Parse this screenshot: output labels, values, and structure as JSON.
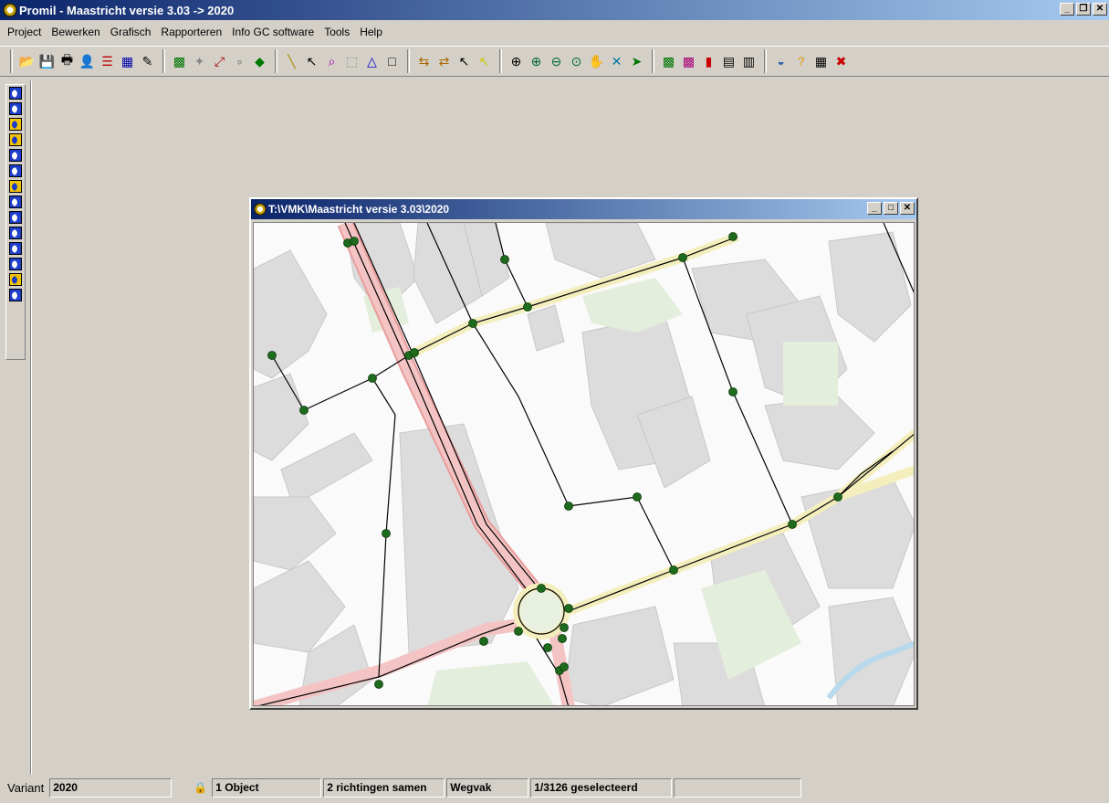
{
  "window": {
    "title": "Promil - Maastricht versie 3.03 -> 2020"
  },
  "menu": [
    "Project",
    "Bewerken",
    "Grafisch",
    "Rapporteren",
    "Info GC software",
    "Tools",
    "Help"
  ],
  "toolbar": {
    "groups": [
      [
        "folder-open-icon",
        "save-icon",
        "print-icon",
        "user-icon",
        "list-icon",
        "table-icon",
        "wizard-icon"
      ],
      [
        "map-edit-icon",
        "node-icon",
        "link-icon",
        "connect-icon",
        "layer-icon"
      ],
      [
        "line-tool-icon",
        "select-arrow-icon",
        "zoom-select-icon",
        "rectangle-dashed-icon",
        "triangle-icon",
        "square-icon"
      ],
      [
        "route-forward-icon",
        "route-back-icon",
        "pointer-icon",
        "pointer-yellow-icon"
      ],
      [
        "zoom-extent-icon",
        "zoom-in-icon",
        "zoom-out-icon",
        "zoom-window-icon",
        "pan-hand-icon",
        "cross-icon",
        "export-icon"
      ],
      [
        "map-stats-icon",
        "map-edit2-icon",
        "bar-chart-icon",
        "report-icon",
        "document-icon"
      ],
      [
        "globe-icon",
        "help-icon",
        "calculator-icon",
        "exit-icon"
      ]
    ]
  },
  "leftbar": [
    "blue",
    "blue",
    "yellow",
    "yellow",
    "blue",
    "blue",
    "yellow",
    "blue",
    "blue",
    "blue",
    "blue",
    "blue",
    "yellow",
    "blue"
  ],
  "mdi": {
    "title": "T:\\VMK\\Maastricht versie 3.03\\2020"
  },
  "status": {
    "variant_label": "Variant",
    "variant_value": "2020",
    "objects": "1 Object",
    "direction": "2 richtingen samen",
    "type": "Wegvak",
    "selected": "1/3126 geselecteerd",
    "extra": ""
  },
  "colors": {
    "titlebar": "#0a246a",
    "major_road": "#f2b8b8",
    "minor_road": "#f7f1c0",
    "node": "#1e6b1e",
    "building": "#d9d9d9"
  }
}
